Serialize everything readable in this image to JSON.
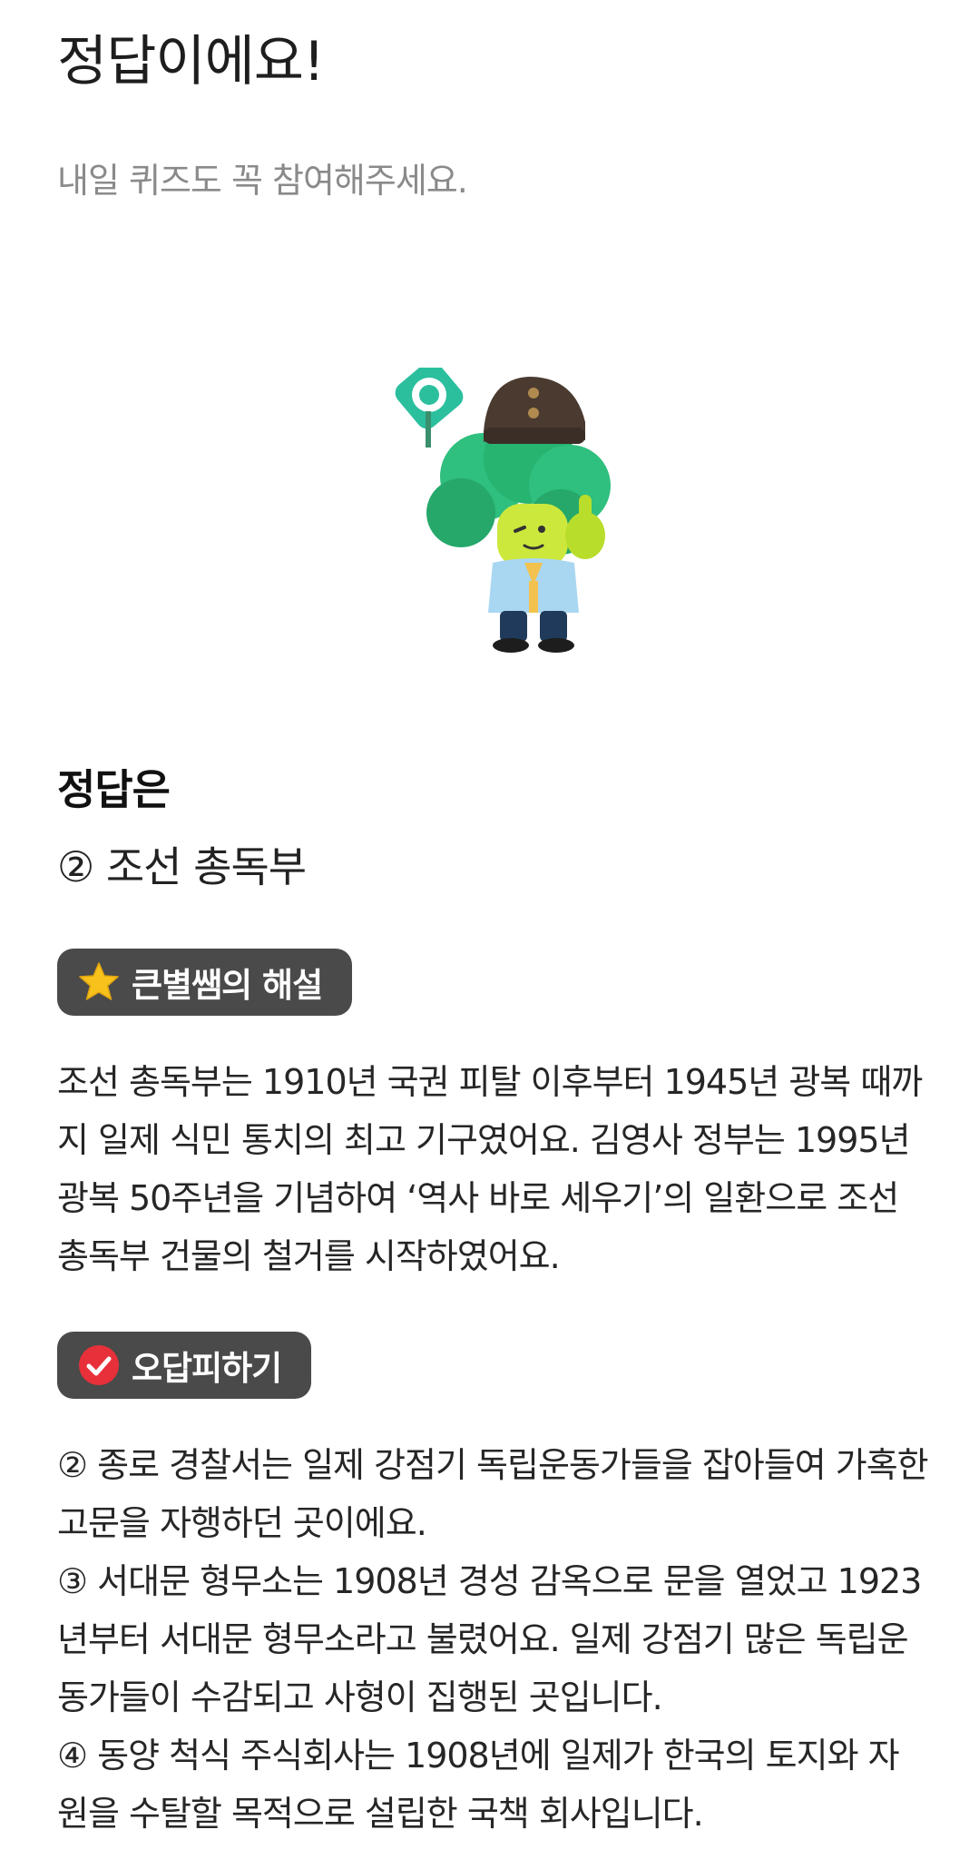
{
  "header": {
    "title": "정답이에요!",
    "subtitle": "내일 퀴즈도 꼭 참여해주세요."
  },
  "mascot": {
    "icon": "broccoli-mascot-thumbs-up-icon",
    "sign_icon": "circle-o-sign-icon"
  },
  "answer": {
    "heading": "정답은",
    "value": "② 조선 총독부"
  },
  "explanation": {
    "badge_icon": "star-icon",
    "badge_label": "큰별쌤의 해설",
    "text": "조선 총독부는 1910년 국권 피탈 이후부터 1945년 광복 때까지 일제 식민 통치의 최고 기구였어요. 김영사 정부는 1995년 광복 50주년을 기념하여 ‘역사 바로 세우기’의 일환으로 조선 총독부 건물의 철거를 시작하였어요."
  },
  "wrong_answers": {
    "badge_icon": "check-circle-icon",
    "badge_label": "오답피하기",
    "items": [
      "② 종로 경찰서는 일제 강점기 독립운동가들을 잡아들여 가혹한 고문을 자행하던 곳이에요.",
      "③ 서대문 형무소는 1908년 경성 감옥으로 문을 열었고 1923년부터 서대문 형무소라고 불렸어요. 일제 강점기 많은 독립운동가들이 수감되고 사형이 집행된 곳입니다.",
      "④ 동양 척식 주식회사는 1908년에 일제가 한국의 토지와 자원을 수탈할 목적으로 설립한 국책 회사입니다."
    ]
  },
  "colors": {
    "badge_bg": "#4a4a4a",
    "star": "#f7c21b",
    "check": "#e8303a",
    "mascot_green": "#2fbf7e"
  }
}
